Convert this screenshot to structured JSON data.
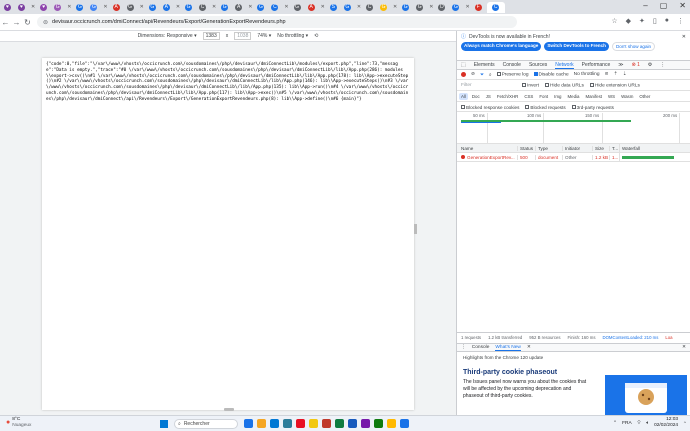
{
  "browser": {
    "url": "devisaur.occicrunch.com/dmiConnect/api/Revendeurs/Export/GenerationExportRevendeurs.php",
    "tab_colors": [
      "#7b3fa0",
      "#7b3fa0",
      "#8e44ad",
      "#9b59b6",
      "#1a73e8",
      "#4285f4",
      "#d93025",
      "#5f6368",
      "#1a73e8",
      "#1a73e8",
      "#1a73e8",
      "#5f6368",
      "#1a73e8",
      "#5f6368",
      "#1a73e8",
      "#1a73e8",
      "#5f6368",
      "#d93025",
      "#1a73e8",
      "#1a73e8",
      "#5f6368",
      "#fbbc04",
      "#1a73e8",
      "#5f6368",
      "#5f6368",
      "#1a73e8",
      "#d93025",
      "#1a73e8"
    ],
    "tab_letters": [
      "♥",
      "♥",
      "♥",
      "G",
      "G",
      "G",
      "A",
      "G",
      "G",
      "A",
      "G",
      "C",
      "G",
      "A",
      "G",
      "C",
      "G",
      "A",
      "S",
      "G",
      "C",
      "G",
      "G",
      "G",
      "D",
      "G",
      "F",
      "C"
    ],
    "window_controls": [
      "–",
      "▢",
      "✕"
    ]
  },
  "device_toolbar": {
    "dimensions_label": "Dimensions: Responsive ▾",
    "width": "1383",
    "times": "x",
    "height": "1038",
    "zoom": "74% ▾",
    "throttle": "No throttling ▾"
  },
  "page": {
    "response": "{\"code\":0,\"file\":\"\\/var\\/www\\/vhosts\\/occicrunch.com\\/sousdomaines\\/php\\/devisaur\\/dmiConnectLib\\/modules\\/export.php\",\"line\":73,\"message\":\"Data is empty.\",\"trace\":\"#0 \\/var\\/www\\/vhosts\\/occicrunch.com\\/sousdomaines\\/php\\/devisaur\\/dmiConnectLib\\/lib\\/App.php(286): modules\\\\export->csv()\\n#1 \\/var\\/www\\/vhosts\\/occicrunch.com\\/sousdomaines\\/php\\/devisaur\\/dmiConnectLib\\/lib\\/App.php(178): lib\\\\App->executeStep()\\n#2 \\/var\\/www\\/vhosts\\/occicrunch.com\\/sousdomaines\\/php\\/devisaur\\/dmiConnectLib\\/lib\\/App.php(146): lib\\\\App->executeSteps()\\n#3 \\/var\\/www\\/vhosts\\/occicrunch.com\\/sousdomaines\\/php\\/devisaur\\/dmiConnectLib\\/lib\\/App.php(135): lib\\\\App->run()\\n#4 \\/var\\/www\\/vhosts\\/occicrunch.com\\/sousdomaines\\/php\\/devisaur\\/dmiConnectLib\\/lib\\/App.php(117): lib\\\\App->exec()\\n#5 \\/var\\/www\\/vhosts\\/occicrunch.com\\/sousdomaines\\/php\\/devisaur\\/dmiConnect\\/api\\/Revendeurs\\/Export\\/GenerationExportRevendeurs.php(8): lib\\\\App->define()\\n#6 {main}\"}"
  },
  "devtools": {
    "info_text": "DevTools is now available in French!",
    "btn_match": "Always match Chrome's language",
    "btn_switch": "Switch DevTools to French",
    "btn_dont": "Don't show again",
    "tabs": [
      "Elements",
      "Console",
      "Sources",
      "Network",
      "Performance",
      "≫"
    ],
    "active_tab": "Network",
    "error_badge": "1",
    "toolbar": {
      "preserve_log": "Preserve log",
      "disable_cache": "Disable cache",
      "throttle": "No throttling"
    },
    "filter": {
      "placeholder": "Filter",
      "invert": "Invert",
      "hide_data": "Hide data URLs",
      "hide_ext": "Hide extension URLs"
    },
    "types": [
      "All",
      "Doc",
      "JS",
      "Fetch/XHR",
      "CSS",
      "Font",
      "Img",
      "Media",
      "Manifest",
      "WS",
      "Wasm",
      "Other"
    ],
    "blocked": {
      "response": "Blocked response cookies",
      "requests": "Blocked requests",
      "third": "3rd-party requests"
    },
    "overview_ticks": [
      "50 ms",
      "100 ms",
      "150 ms",
      "200 ms"
    ],
    "columns": [
      "Name",
      "Status",
      "Type",
      "Initiator",
      "Size",
      "T...",
      "Waterfall"
    ],
    "rows": [
      {
        "name": "GenerationExportRev...",
        "status": "500",
        "type": "document",
        "initiator": "Other",
        "size": "1.2 kB",
        "time": "1..."
      }
    ],
    "summary": {
      "requests": "1 requests",
      "transferred": "1.2 kB transferred",
      "resources": "952 B resources",
      "finish": "Finish: 160 ms",
      "dcl": "DOMContentLoaded: 210 ms",
      "load": "Loa"
    },
    "drawer_tabs": [
      "Console",
      "What's New"
    ],
    "drawer_active": "What's New",
    "highlights": "Highlights from the Chrome 120 update",
    "card_title": "Third-party cookie phaseout",
    "card_text": "The Issues panel now warns you about the cookies that will be affected by the upcoming deprecation and phaseout of third-party cookies."
  },
  "taskbar": {
    "temp": "8°C",
    "weather": "Nuageux",
    "search": "Rechercher",
    "app_colors": [
      "#1a73e8",
      "#f5a623",
      "#0078d4",
      "#2d7d9a",
      "#e81123",
      "#f2c811",
      "#c0392b",
      "#107c41",
      "#185abd",
      "#7719aa",
      "#0f7b0f",
      "#ffb900",
      "#1a73e8"
    ],
    "lang": "FRA",
    "time": "12:03",
    "date": "02/02/2024"
  }
}
